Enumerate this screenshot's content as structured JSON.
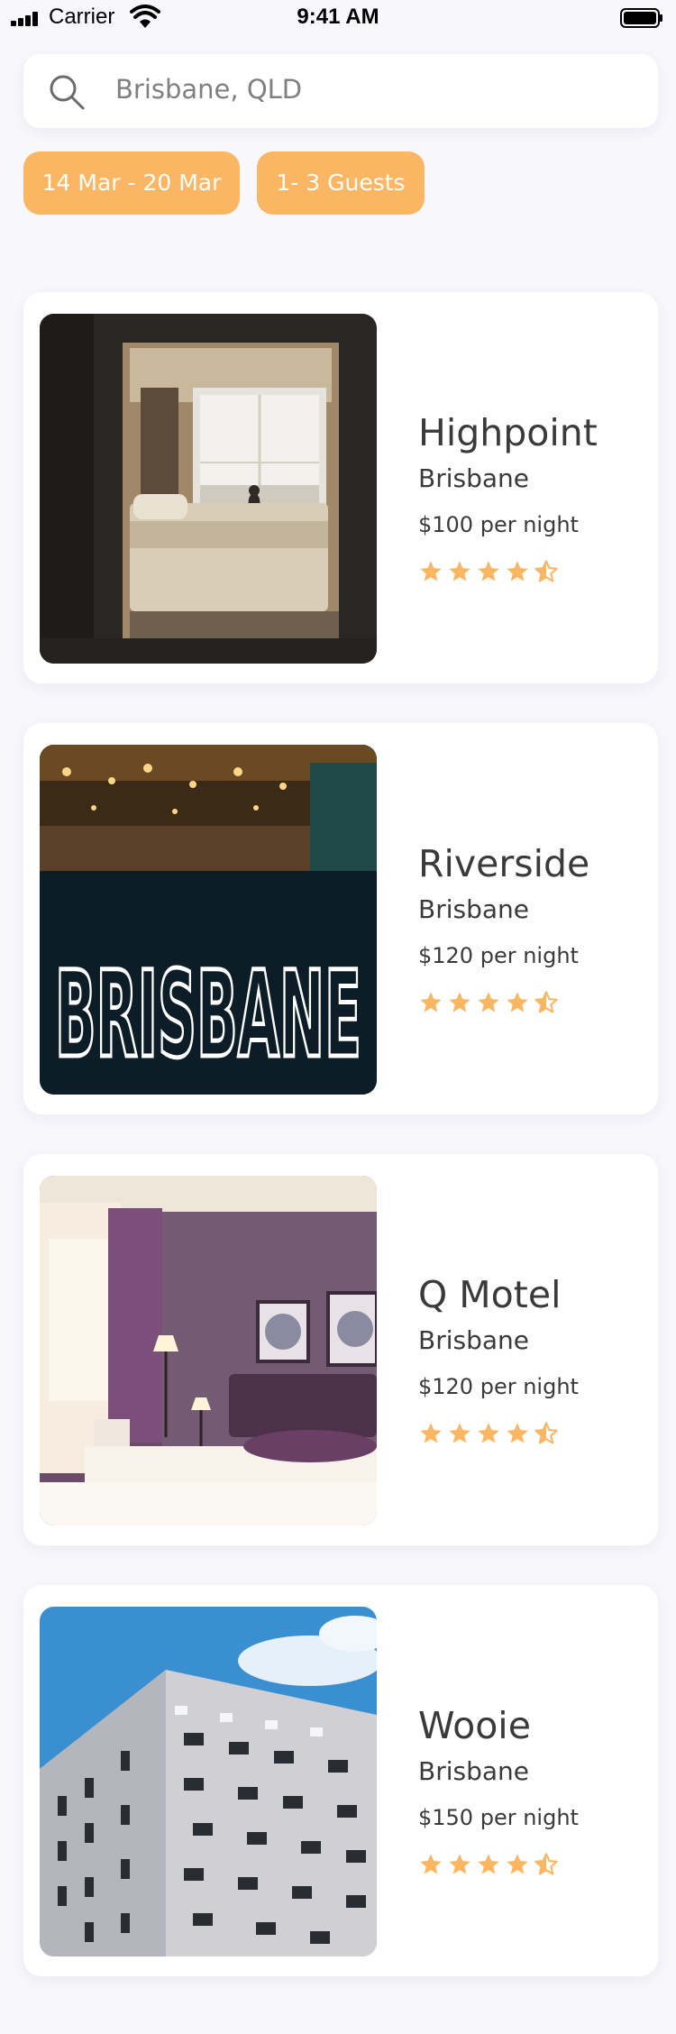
{
  "status_bar": {
    "carrier": "Carrier",
    "time": "9:41 AM"
  },
  "search": {
    "icon": "search-icon",
    "value": "Brisbane, QLD"
  },
  "filters": {
    "dates": "14 Mar - 20 Mar",
    "guests": "1- 3 Guests"
  },
  "colors": {
    "accent": "#fbb663",
    "background": "#f7f7fc",
    "text": "#3a3a3a"
  },
  "hotels": [
    {
      "name": "Highpoint",
      "city": "Brisbane",
      "price": "$100 per night",
      "rating": 4.5,
      "photo": "hotel-bedroom-window"
    },
    {
      "name": "Riverside",
      "city": "Brisbane",
      "price": "$120 per night",
      "rating": 4.5,
      "photo": "brisbane-neon-sign"
    },
    {
      "name": "Q Motel",
      "city": "Brisbane",
      "price": "$120 per night",
      "rating": 4.5,
      "photo": "motel-bedroom-lamp"
    },
    {
      "name": "Wooie",
      "city": "Brisbane",
      "price": "$150 per night",
      "rating": 4.5,
      "photo": "building-facade-sky"
    }
  ]
}
